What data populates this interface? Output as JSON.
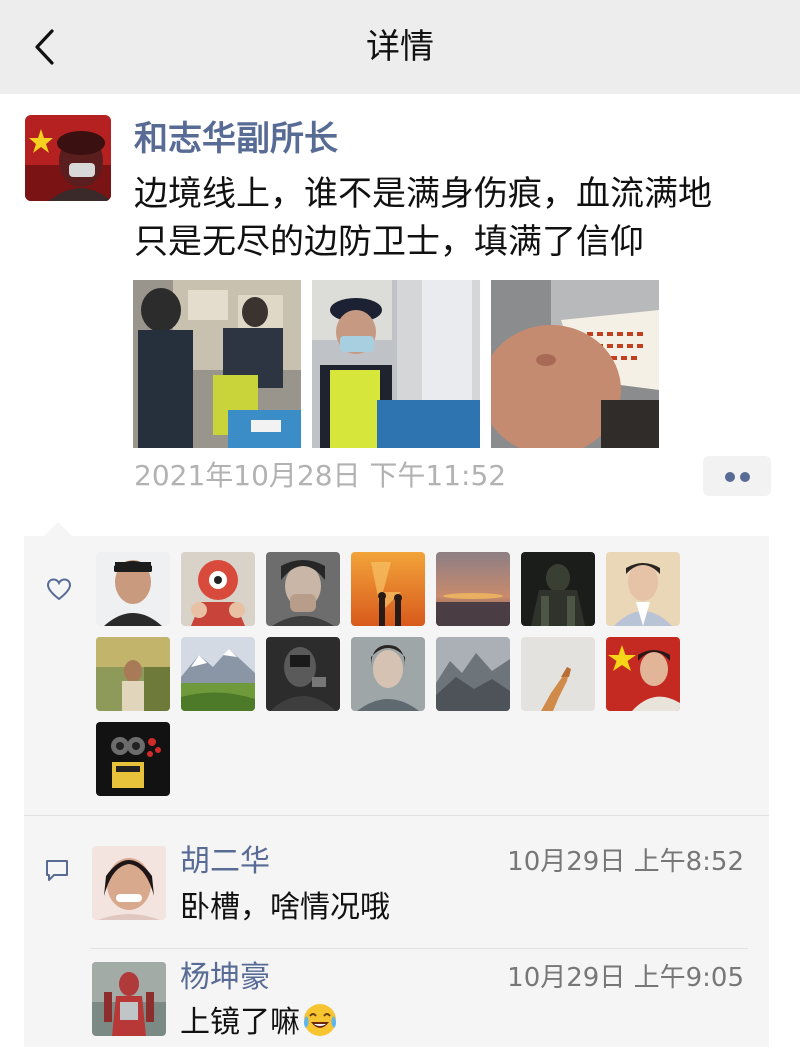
{
  "nav": {
    "title": "详情"
  },
  "post": {
    "author": "和志华副所长",
    "lines": [
      "边境线上，谁不是满身伤痕，血流满地",
      "只是无尽的边防卫士，填满了信仰"
    ],
    "time": "2021年10月28日 下午11:52"
  },
  "colors": {
    "link": "#576b95",
    "nav_bg": "#ededed",
    "panel_bg": "#f5f5f5",
    "timestamp": "#b2b2b2"
  },
  "icons": [
    "back-chevron-icon",
    "heart-icon",
    "comment-bubble-icon",
    "more-dots-icon",
    "tears-of-joy-emoji-icon"
  ],
  "comments": [
    {
      "name": "胡二华",
      "time": "10月29日 上午8:52",
      "text": "卧槽，啥情况哦"
    },
    {
      "name": "杨坤豪",
      "time": "10月29日 上午9:05",
      "text": "上镜了嘛",
      "emoji": "tears-of-joy-emoji-icon"
    }
  ]
}
